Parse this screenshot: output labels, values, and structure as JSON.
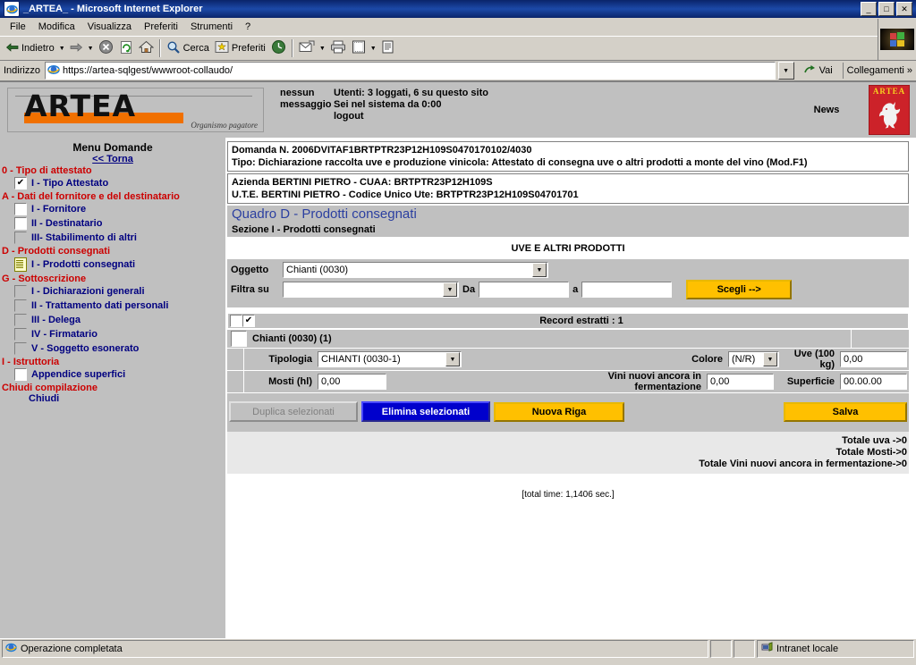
{
  "window": {
    "title": "_ARTEA_ - Microsoft Internet Explorer",
    "minimize": "_",
    "maximize": "□",
    "close": "✕"
  },
  "menubar": {
    "items": [
      "File",
      "Modifica",
      "Visualizza",
      "Preferiti",
      "Strumenti",
      "?"
    ]
  },
  "toolbar": {
    "back": "Indietro",
    "forward": "",
    "stop": "stop-icon",
    "refresh": "refresh-icon",
    "home": "home-icon",
    "search": "Cerca",
    "favorites": "Preferiti",
    "history": "history-icon",
    "mail": "mail-icon",
    "print": "print-icon",
    "edit": "edit-icon",
    "discuss": "discuss-icon"
  },
  "address": {
    "label": "Indirizzo",
    "url": "https://artea-sqlgest/wwwroot-collaudo/",
    "go": "Vai",
    "links": "Collegamenti",
    "chevron": "»"
  },
  "banner": {
    "logo_text": "ARTEA",
    "logo_subtitle": "Organismo pagatore",
    "message_line1": "nessun",
    "message_line2": "messaggio",
    "users_line1": "Utenti: 3 loggati, 6 su questo sito",
    "users_line2": "Sei nel sistema da 0:00",
    "logout": "logout",
    "news": "News",
    "shield_text": "ARTEA"
  },
  "sidebar": {
    "title": "Menu Domande",
    "back_link": "<< Torna",
    "groups": [
      {
        "heading": "0 - Tipo di attestato",
        "items": [
          {
            "label": "I - Tipo Attestato",
            "icon": "checkbox-checked",
            "checked": true
          }
        ]
      },
      {
        "heading": "A - Dati del fornitore e del destinatario",
        "items": [
          {
            "label": "I - Fornitore",
            "icon": "checkbox-empty",
            "checked": false
          },
          {
            "label": "II - Destinatario",
            "icon": "checkbox-empty",
            "checked": false
          },
          {
            "label": "III- Stabilimento di altri",
            "icon": "checkbox-flat",
            "checked": false
          }
        ]
      },
      {
        "heading": "D - Prodotti consegnati",
        "items": [
          {
            "label": "I - Prodotti consegnati",
            "icon": "document-icon",
            "checked": false
          }
        ]
      },
      {
        "heading": "G - Sottoscrizione",
        "items": [
          {
            "label": "I - Dichiarazioni generali",
            "icon": "checkbox-flat",
            "checked": false
          },
          {
            "label": "II - Trattamento dati personali",
            "icon": "checkbox-flat",
            "checked": false
          },
          {
            "label": "III - Delega",
            "icon": "checkbox-flat",
            "checked": false
          },
          {
            "label": "IV - Firmatario",
            "icon": "checkbox-flat",
            "checked": false
          },
          {
            "label": "V - Soggetto esonerato",
            "icon": "checkbox-flat",
            "checked": false
          }
        ]
      },
      {
        "heading": "I - Istruttoria",
        "items": [
          {
            "label": "Appendice superfici",
            "icon": "checkbox-empty",
            "checked": false
          }
        ]
      }
    ],
    "close_heading": "Chiudi compilazione",
    "close_link": "Chiudi"
  },
  "main": {
    "domanda_line1": "Domanda N. 2006DVITAF1BRTPTR23P12H109S0470170102/4030",
    "domanda_line2": "Tipo: Dichiarazione raccolta uve e produzione vinicola: Attestato di consegna uve o altri prodotti a monte del vino (Mod.F1)",
    "azienda_line1": "Azienda BERTINI PIETRO - CUAA: BRTPTR23P12H109S",
    "azienda_line2": "U.T.E. BERTINI PIETRO - Codice Unico Ute: BRTPTR23P12H109S04701701",
    "quadro": "Quadro D - Prodotti consegnati",
    "sezione": "Sezione I - Prodotti consegnati",
    "section_title": "UVE E ALTRI PRODOTTI",
    "filter": {
      "oggetto_label": "Oggetto",
      "oggetto_value": "Chianti (0030)",
      "filtra_label": "Filtra su",
      "filtra_value": "",
      "da_label": "Da",
      "da_value": "",
      "a_label": "a",
      "a_value": "",
      "scegli_button": "Scegli -->"
    },
    "records_header": "Record estratti : 1",
    "group_label": "Chianti (0030) (1)",
    "fields": {
      "tipologia_label": "Tipologia",
      "tipologia_value": "CHIANTI (0030-1)",
      "colore_label": "Colore",
      "colore_value": "(N/R)",
      "uve_label": "Uve (100 kg)",
      "uve_value": "0,00",
      "mosti_label": "Mosti (hl)",
      "mosti_value": "0,00",
      "vini_label": "Vini nuovi ancora in fermentazione",
      "vini_value": "0,00",
      "superficie_label": "Superficie",
      "superficie_value": "00.00.00"
    },
    "buttons": {
      "duplica": "Duplica selezionati",
      "elimina": "Elimina selezionati",
      "nuova_riga": "Nuova Riga",
      "salva": "Salva"
    },
    "totals": [
      "Totale uva ->0",
      "Totale Mosti->0",
      "Totale Vini nuovi ancora in fermentazione->0"
    ],
    "timing": "[total time: 1,1406 sec.]"
  },
  "statusbar": {
    "message": "Operazione completata",
    "zone": "Intranet locale"
  },
  "colors": {
    "accent_yellow": "#ffc000",
    "selected_blue": "#0000cc",
    "heading_red": "#cc0000",
    "link_blue": "#000080",
    "banner_grey": "#c0c0c0"
  }
}
